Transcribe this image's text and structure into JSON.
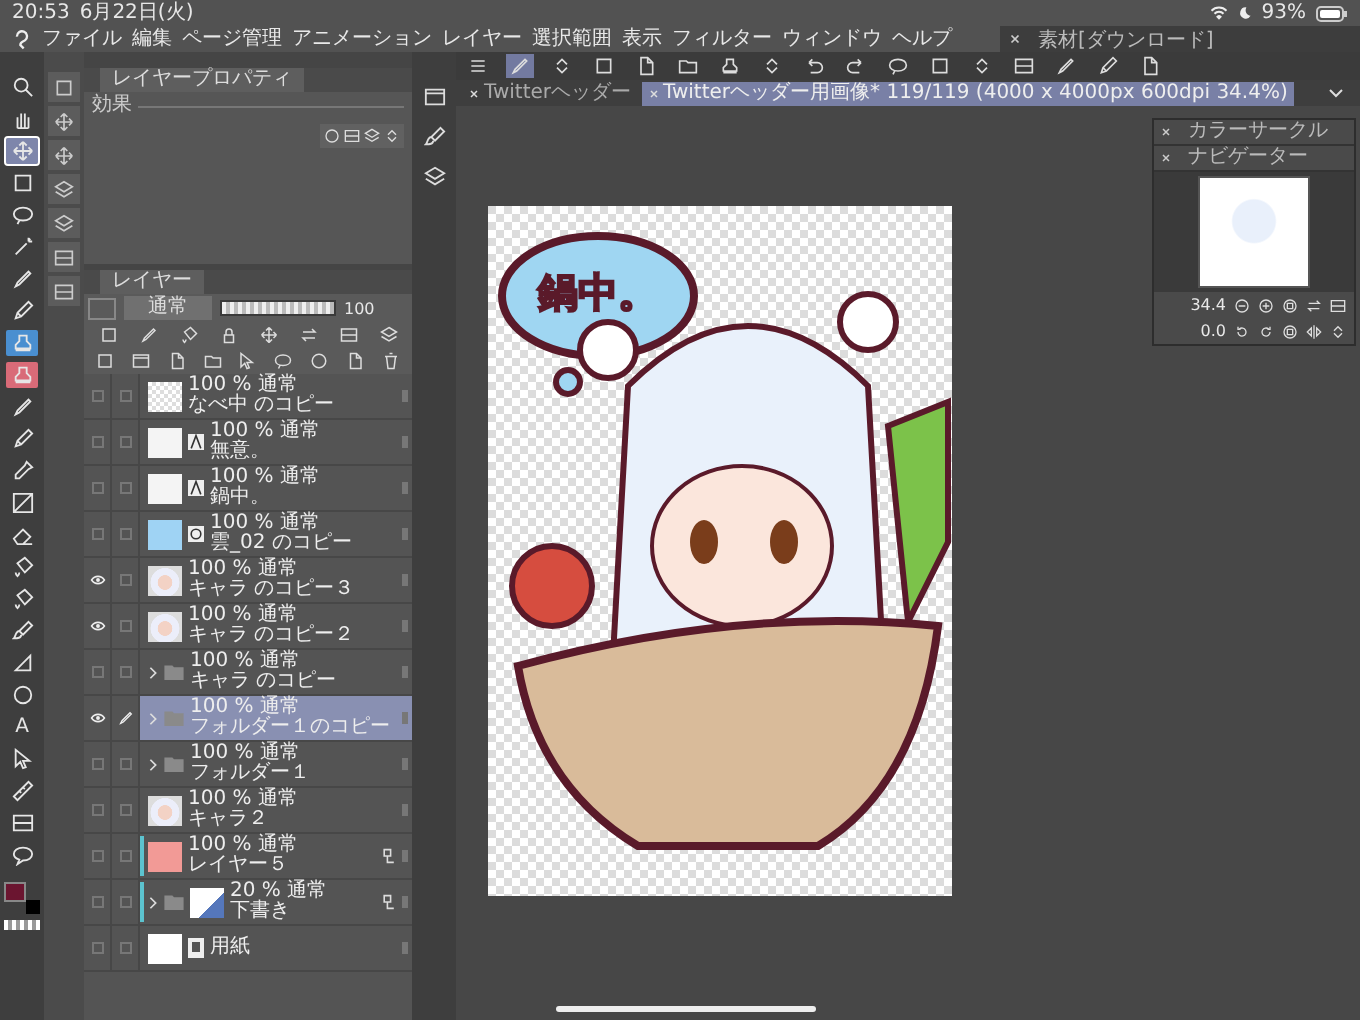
{
  "status_bar": {
    "time": "20:53",
    "date": "6月22日(火)",
    "battery": "93%"
  },
  "menu": [
    "ファイル",
    "編集",
    "ページ管理",
    "アニメーション",
    "レイヤー",
    "選択範囲",
    "表示",
    "フィルター",
    "ウィンドウ",
    "ヘルプ"
  ],
  "material_window": {
    "title": "素材[ダウンロード]"
  },
  "tools": [
    {
      "kind": "zoom",
      "selected": false
    },
    {
      "kind": "hand",
      "selected": false
    },
    {
      "kind": "move",
      "selected": true
    },
    {
      "kind": "rect",
      "selected": false
    },
    {
      "kind": "lasso",
      "selected": false
    },
    {
      "kind": "wand",
      "selected": false
    },
    {
      "kind": "pen",
      "selected": false
    },
    {
      "kind": "pencil",
      "selected": false
    },
    {
      "kind": "stamp",
      "selected": false,
      "color": "#4a8fd0"
    },
    {
      "kind": "stamp",
      "selected": false,
      "color": "#d96b78"
    },
    {
      "kind": "pen",
      "selected": false
    },
    {
      "kind": "pencil",
      "selected": false
    },
    {
      "kind": "eyedropper",
      "selected": false
    },
    {
      "kind": "gradient",
      "selected": false
    },
    {
      "kind": "eraser",
      "selected": false
    },
    {
      "kind": "fill",
      "selected": false
    },
    {
      "kind": "fill",
      "selected": false
    },
    {
      "kind": "brush",
      "selected": false
    },
    {
      "kind": "figure",
      "selected": false
    },
    {
      "kind": "circle",
      "selected": false
    },
    {
      "kind": "text",
      "selected": false,
      "glyph": "A"
    },
    {
      "kind": "select",
      "selected": false
    },
    {
      "kind": "ruler",
      "selected": false
    },
    {
      "kind": "frame",
      "selected": false
    },
    {
      "kind": "balloon",
      "selected": false
    }
  ],
  "swatches": [
    {
      "kind": "main",
      "color": "#6b1530"
    },
    {
      "kind": "sub",
      "color": "#000000"
    }
  ],
  "property_panel": {
    "title": "レイヤープロパティ",
    "effect_label": "効果"
  },
  "layer_panel": {
    "title": "レイヤー",
    "blend_mode": "通常",
    "opacity": {
      "level": 1.0,
      "value": "100"
    },
    "layers": [
      {
        "opacity": "100 %",
        "blend": "通常",
        "name": "なべ中 のコピー",
        "visible": false,
        "editing": false,
        "selected": false,
        "kind": "layer",
        "thumbnail": {
          "kind": "checker"
        },
        "reference": false
      },
      {
        "opacity": "100 %",
        "blend": "通常",
        "name": "無意。",
        "visible": false,
        "editing": false,
        "selected": false,
        "kind": "layer",
        "thumbnail": {
          "kind": "light"
        },
        "badge": {
          "kind": "text"
        },
        "reference": false
      },
      {
        "opacity": "100 %",
        "blend": "通常",
        "name": "鍋中。",
        "visible": false,
        "editing": false,
        "selected": false,
        "kind": "layer",
        "thumbnail": {
          "kind": "light"
        },
        "badge": {
          "kind": "text"
        },
        "reference": false
      },
      {
        "opacity": "100 %",
        "blend": "通常",
        "name": "雲_02 のコピー",
        "visible": false,
        "editing": false,
        "selected": false,
        "kind": "layer",
        "thumbnail": {
          "kind": "blue"
        },
        "badge": {
          "kind": "image"
        },
        "reference": false
      },
      {
        "opacity": "100 %",
        "blend": "通常",
        "name": "キャラ のコピー３",
        "visible": true,
        "editing": false,
        "selected": false,
        "kind": "layer",
        "thumbnail": {
          "kind": "character"
        },
        "reference": false
      },
      {
        "opacity": "100 %",
        "blend": "通常",
        "name": "キャラ のコピー２",
        "visible": true,
        "editing": false,
        "selected": false,
        "kind": "layer",
        "thumbnail": {
          "kind": "character"
        },
        "reference": false
      },
      {
        "opacity": "100 %",
        "blend": "通常",
        "name": "キャラ のコピー",
        "visible": false,
        "editing": false,
        "selected": false,
        "kind": "folder",
        "reference": false
      },
      {
        "opacity": "100 %",
        "blend": "通常",
        "name": "フォルダー１のコピー",
        "visible": true,
        "editing": true,
        "selected": true,
        "kind": "folder",
        "reference": false
      },
      {
        "opacity": "100 %",
        "blend": "通常",
        "name": "フォルダー１",
        "visible": false,
        "editing": false,
        "selected": false,
        "kind": "folder",
        "reference": false
      },
      {
        "opacity": "100 %",
        "blend": "通常",
        "name": "キャラ２",
        "visible": false,
        "editing": false,
        "selected": false,
        "kind": "layer",
        "thumbnail": {
          "kind": "character"
        },
        "reference": false
      },
      {
        "opacity": "100 %",
        "blend": "通常",
        "name": "レイヤー５",
        "visible": false,
        "editing": false,
        "selected": false,
        "kind": "layer",
        "thumbnail": {
          "kind": "pink"
        },
        "reference": true,
        "color": "#5cc3cf"
      },
      {
        "opacity": "20 %",
        "blend": "通常",
        "name": "下書き",
        "visible": false,
        "editing": false,
        "selected": false,
        "kind": "folder",
        "thumbnail": {
          "kind": "sketch"
        },
        "reference": true,
        "color": "#5cc3cf"
      },
      {
        "name": "用紙",
        "visible": false,
        "editing": false,
        "selected": false,
        "kind": "paper",
        "thumbnail": {
          "kind": "white"
        },
        "badge": {
          "kind": "paper"
        },
        "reference": false
      }
    ]
  },
  "tabs": [
    {
      "label": "Twitterヘッダー",
      "selected": false
    },
    {
      "label": "Twitterヘッダー用画像* 119/119 (4000 x 4000px 600dpi 34.4%)",
      "selected": true
    }
  ],
  "canvas": {
    "bubble_text": "鍋中。"
  },
  "navigator": {
    "color_title": "カラーサークル",
    "title": "ナビゲーター",
    "zoom": "34.4",
    "angle": "0.0"
  }
}
